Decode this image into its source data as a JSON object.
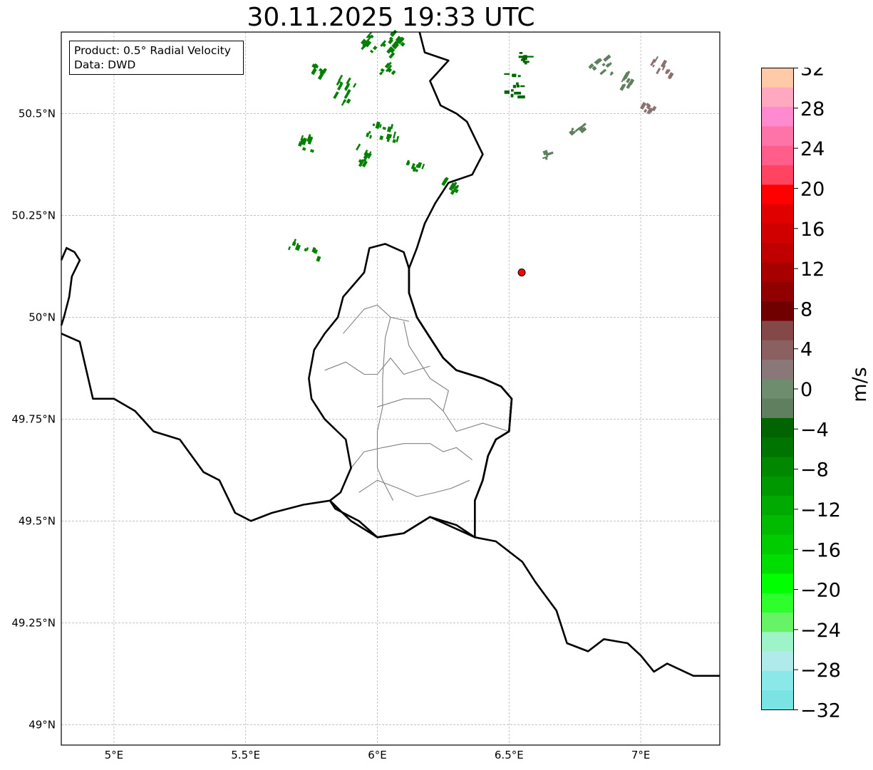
{
  "title": "30.11.2025 19:33 UTC",
  "info": {
    "product": "Product: 0.5° Radial Velocity",
    "data": "Data: DWD"
  },
  "map": {
    "lon_range": [
      4.8,
      7.3
    ],
    "lat_range": [
      48.95,
      50.7
    ],
    "lon_ticks": [
      {
        "value": 5.0,
        "label": "5°E"
      },
      {
        "value": 5.5,
        "label": "5.5°E"
      },
      {
        "value": 6.0,
        "label": "6°E"
      },
      {
        "value": 6.5,
        "label": "6.5°E"
      },
      {
        "value": 7.0,
        "label": "7°E"
      }
    ],
    "lat_ticks": [
      {
        "value": 49.0,
        "label": "49°N"
      },
      {
        "value": 49.25,
        "label": "49.25°N"
      },
      {
        "value": 49.5,
        "label": "49.5°N"
      },
      {
        "value": 49.75,
        "label": "49.75°N"
      },
      {
        "value": 50.0,
        "label": "50°N"
      },
      {
        "value": 50.25,
        "label": "50.25°N"
      },
      {
        "value": 50.5,
        "label": "50.5°N"
      }
    ],
    "grid": true,
    "radar_site": {
      "lon": 6.548,
      "lat": 50.11,
      "color": "#ff0000"
    },
    "country_borders": [
      [
        [
          4.8,
          49.96
        ],
        [
          4.87,
          49.94
        ],
        [
          4.92,
          49.8
        ],
        [
          5.0,
          49.8
        ],
        [
          5.08,
          49.77
        ],
        [
          5.15,
          49.72
        ],
        [
          5.25,
          49.7
        ],
        [
          5.34,
          49.62
        ],
        [
          5.4,
          49.6
        ],
        [
          5.46,
          49.52
        ],
        [
          5.52,
          49.5
        ],
        [
          5.6,
          49.52
        ],
        [
          5.72,
          49.54
        ],
        [
          5.82,
          49.55
        ],
        [
          5.9,
          49.5
        ],
        [
          6.0,
          49.46
        ],
        [
          6.1,
          49.47
        ],
        [
          6.2,
          49.51
        ],
        [
          6.3,
          49.49
        ],
        [
          6.37,
          49.46
        ],
        [
          6.45,
          49.45
        ],
        [
          6.55,
          49.4
        ],
        [
          6.6,
          49.35
        ],
        [
          6.68,
          49.28
        ],
        [
          6.72,
          49.2
        ],
        [
          6.8,
          49.18
        ],
        [
          6.86,
          49.21
        ],
        [
          6.95,
          49.2
        ],
        [
          7.0,
          49.17
        ],
        [
          7.05,
          49.13
        ],
        [
          7.1,
          49.15
        ],
        [
          7.2,
          49.12
        ],
        [
          7.3,
          49.12
        ]
      ],
      [
        [
          6.37,
          49.46
        ],
        [
          6.37,
          49.55
        ],
        [
          6.4,
          49.6
        ],
        [
          6.42,
          49.66
        ],
        [
          6.45,
          49.7
        ],
        [
          6.5,
          49.72
        ],
        [
          6.51,
          49.8
        ],
        [
          6.47,
          49.83
        ],
        [
          6.4,
          49.85
        ],
        [
          6.3,
          49.87
        ],
        [
          6.25,
          49.9
        ],
        [
          6.2,
          49.95
        ],
        [
          6.15,
          50.0
        ],
        [
          6.12,
          50.06
        ],
        [
          6.12,
          50.12
        ],
        [
          6.15,
          50.17
        ],
        [
          6.18,
          50.23
        ],
        [
          6.22,
          50.28
        ],
        [
          6.27,
          50.33
        ],
        [
          6.36,
          50.35
        ],
        [
          6.4,
          50.4
        ],
        [
          6.34,
          50.48
        ],
        [
          6.3,
          50.5
        ],
        [
          6.24,
          50.52
        ],
        [
          6.2,
          50.58
        ],
        [
          6.27,
          50.63
        ],
        [
          6.18,
          50.65
        ],
        [
          6.16,
          50.7
        ]
      ]
    ],
    "luxembourg_border": [
      [
        6.37,
        49.46
      ],
      [
        6.2,
        49.51
      ],
      [
        6.1,
        49.47
      ],
      [
        6.0,
        49.46
      ],
      [
        5.93,
        49.5
      ],
      [
        5.84,
        49.53
      ],
      [
        5.82,
        49.55
      ],
      [
        5.86,
        49.57
      ],
      [
        5.9,
        49.63
      ],
      [
        5.88,
        49.7
      ],
      [
        5.8,
        49.75
      ],
      [
        5.75,
        49.8
      ],
      [
        5.74,
        49.85
      ],
      [
        5.76,
        49.92
      ],
      [
        5.8,
        49.96
      ],
      [
        5.85,
        50.0
      ],
      [
        5.87,
        50.05
      ],
      [
        5.95,
        50.11
      ],
      [
        5.97,
        50.17
      ],
      [
        6.03,
        50.18
      ],
      [
        6.1,
        50.16
      ],
      [
        6.12,
        50.12
      ],
      [
        6.12,
        50.06
      ],
      [
        6.15,
        50.0
      ],
      [
        6.2,
        49.95
      ],
      [
        6.25,
        49.9
      ],
      [
        6.3,
        49.87
      ],
      [
        6.4,
        49.85
      ],
      [
        6.47,
        49.83
      ],
      [
        6.51,
        49.8
      ],
      [
        6.5,
        49.72
      ],
      [
        6.45,
        49.7
      ],
      [
        6.42,
        49.66
      ],
      [
        6.4,
        49.6
      ],
      [
        6.37,
        49.55
      ],
      [
        6.37,
        49.46
      ]
    ],
    "internal_borders": [
      [
        [
          5.87,
          49.96
        ],
        [
          5.95,
          50.02
        ],
        [
          6.0,
          50.03
        ],
        [
          6.05,
          50.0
        ],
        [
          6.12,
          49.99
        ]
      ],
      [
        [
          5.8,
          49.87
        ],
        [
          5.88,
          49.89
        ],
        [
          5.95,
          49.86
        ],
        [
          6.0,
          49.86
        ],
        [
          6.05,
          49.9
        ],
        [
          6.1,
          49.86
        ],
        [
          6.2,
          49.88
        ]
      ],
      [
        [
          6.05,
          50.0
        ],
        [
          6.03,
          49.95
        ],
        [
          6.02,
          49.85
        ],
        [
          6.02,
          49.78
        ],
        [
          6.0,
          49.72
        ],
        [
          6.0,
          49.63
        ],
        [
          6.02,
          49.6
        ],
        [
          6.06,
          49.55
        ]
      ],
      [
        [
          5.9,
          49.63
        ],
        [
          5.95,
          49.67
        ],
        [
          6.02,
          49.68
        ],
        [
          6.1,
          49.69
        ],
        [
          6.2,
          49.69
        ],
        [
          6.25,
          49.67
        ],
        [
          6.3,
          49.68
        ],
        [
          6.36,
          49.65
        ]
      ],
      [
        [
          6.0,
          49.78
        ],
        [
          6.1,
          49.8
        ],
        [
          6.2,
          49.8
        ],
        [
          6.25,
          49.77
        ],
        [
          6.3,
          49.72
        ],
        [
          6.4,
          49.74
        ],
        [
          6.5,
          49.72
        ]
      ],
      [
        [
          6.1,
          49.99
        ],
        [
          6.12,
          49.93
        ],
        [
          6.15,
          49.9
        ],
        [
          6.2,
          49.85
        ],
        [
          6.27,
          49.82
        ],
        [
          6.25,
          49.77
        ]
      ],
      [
        [
          5.93,
          49.57
        ],
        [
          6.0,
          49.6
        ],
        [
          6.08,
          49.58
        ],
        [
          6.15,
          49.56
        ],
        [
          6.22,
          49.57
        ],
        [
          6.28,
          49.58
        ],
        [
          6.35,
          49.6
        ]
      ]
    ],
    "echo_clusters": [
      {
        "lon": 5.86,
        "lat": 50.55,
        "w": 0.1,
        "h": 0.05,
        "color": "#008000",
        "a": 60
      },
      {
        "lon": 5.77,
        "lat": 50.6,
        "w": 0.05,
        "h": 0.04,
        "color": "#008000",
        "a": 60
      },
      {
        "lon": 5.96,
        "lat": 50.67,
        "w": 0.07,
        "h": 0.04,
        "color": "#008000",
        "a": 50
      },
      {
        "lon": 6.06,
        "lat": 50.67,
        "w": 0.1,
        "h": 0.05,
        "color": "#008000",
        "a": 50
      },
      {
        "lon": 6.03,
        "lat": 50.6,
        "w": 0.06,
        "h": 0.03,
        "color": "#008000",
        "a": 50
      },
      {
        "lon": 6.01,
        "lat": 50.45,
        "w": 0.06,
        "h": 0.09,
        "color": "#008000",
        "a": 75
      },
      {
        "lon": 5.73,
        "lat": 50.42,
        "w": 0.04,
        "h": 0.06,
        "color": "#008000",
        "a": 70
      },
      {
        "lon": 5.93,
        "lat": 50.39,
        "w": 0.05,
        "h": 0.04,
        "color": "#008000",
        "a": 60
      },
      {
        "lon": 6.13,
        "lat": 50.37,
        "w": 0.03,
        "h": 0.05,
        "color": "#008000",
        "a": 70
      },
      {
        "lon": 6.26,
        "lat": 50.32,
        "w": 0.03,
        "h": 0.05,
        "color": "#008000",
        "a": 60
      },
      {
        "lon": 5.72,
        "lat": 50.16,
        "w": 0.03,
        "h": 0.08,
        "color": "#008000",
        "a": 70
      },
      {
        "lon": 6.51,
        "lat": 50.57,
        "w": 0.07,
        "h": 0.06,
        "color": "#006400",
        "a": 0
      },
      {
        "lon": 6.55,
        "lat": 50.64,
        "w": 0.03,
        "h": 0.03,
        "color": "#006400",
        "a": 0
      },
      {
        "lon": 6.85,
        "lat": 50.61,
        "w": 0.07,
        "h": 0.05,
        "color": "#5f7f5f",
        "a": 40
      },
      {
        "lon": 6.94,
        "lat": 50.57,
        "w": 0.05,
        "h": 0.04,
        "color": "#5f7f5f",
        "a": 60
      },
      {
        "lon": 6.75,
        "lat": 50.46,
        "w": 0.05,
        "h": 0.02,
        "color": "#5f7f5f",
        "a": 40
      },
      {
        "lon": 6.64,
        "lat": 50.4,
        "w": 0.04,
        "h": 0.02,
        "color": "#5f7f5f",
        "a": 20
      },
      {
        "lon": 7.08,
        "lat": 50.6,
        "w": 0.04,
        "h": 0.07,
        "color": "#8b7070",
        "a": 60
      },
      {
        "lon": 7.02,
        "lat": 50.51,
        "w": 0.03,
        "h": 0.03,
        "color": "#8b7070",
        "a": 60
      }
    ],
    "velocity_range_ms": [
      -32,
      32
    ]
  },
  "colorbar": {
    "unit": "m/s",
    "range": [
      -32,
      32
    ],
    "ticks": [
      "32",
      "28",
      "24",
      "20",
      "16",
      "12",
      "8",
      "4",
      "0",
      "−4",
      "−8",
      "−12",
      "−16",
      "−20",
      "−24",
      "−28",
      "−32"
    ],
    "colors_top_to_bottom": [
      "#ffcaa8",
      "#ffa8c0",
      "#ff8ad0",
      "#ff74a8",
      "#ff5e8a",
      "#ff4462",
      "#ff0000",
      "#e00000",
      "#d00000",
      "#c00000",
      "#a80000",
      "#900000",
      "#700000",
      "#854848",
      "#8a6060",
      "#8a7878",
      "#6e8c6e",
      "#5f7f5f",
      "#006400",
      "#007400",
      "#008800",
      "#009800",
      "#00aa00",
      "#00bb00",
      "#00cc00",
      "#00dd00",
      "#00ff00",
      "#2cff2c",
      "#66f466",
      "#9ef4c8",
      "#b0eaea",
      "#8ae8e8",
      "#7ae4e4"
    ]
  }
}
